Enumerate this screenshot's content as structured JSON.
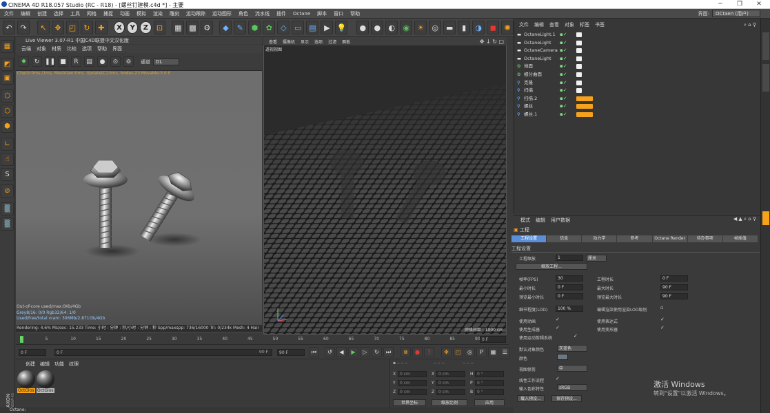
{
  "titlebar": {
    "text": "CINEMA 4D R18.057 Studio (RC - R18) - [螺丝钉建模.c4d *] - 主要",
    "min": "─",
    "max": "❐",
    "close": "✕"
  },
  "menubar": {
    "items": [
      "文件",
      "编辑",
      "创建",
      "选择",
      "工具",
      "网格",
      "捕捉",
      "动画",
      "模拟",
      "渲染",
      "雕刻",
      "运动跟踪",
      "运动图形",
      "角色",
      "流水线",
      "插件",
      "Octane",
      "脚本",
      "窗口",
      "帮助"
    ]
  },
  "interface": {
    "label": "界面:",
    "value": "OCtaen (用户)"
  },
  "live_viewer": {
    "title": "Live Viewer 3.07-R1 中国C4D联盟中文汉化版",
    "menu": [
      "云端",
      "对象",
      "材质",
      "比较",
      "选项",
      "帮助",
      "界面"
    ],
    "channel_label": "通道",
    "channel_value": "DL",
    "check_line": "Check:0ms./1ms. MeshGen:0ms. Update[C]:0ms. Nodes:23 Movable:3  0 0",
    "status": {
      "l1": "Out-of-core used/max:0Kb/4Gb",
      "l2": "Grey8/16: 0/0        Rgb32/64: 1/0",
      "l3": "Used/free/total vram: 306Mb/2.871Gb/4Gb",
      "l4": "Rendering: 4.6%    Ms/sec: 15.233   Time: 小时 : 分钟 : 秒/小时 : 分钟 : 秒    Spp/maxspp: 736/16000   Tri: 0/234k   Mesh: 4   Hair"
    }
  },
  "viewport": {
    "menu": [
      "查看",
      "摄像机",
      "显示",
      "选项",
      "过滤",
      "面板"
    ],
    "label": "透视视图",
    "grid_text": "网格间距 : 1000 cm"
  },
  "timeline": {
    "ticks": [
      "0",
      "5",
      "10",
      "15",
      "20",
      "25",
      "30",
      "35",
      "40",
      "45",
      "50",
      "55",
      "60",
      "65",
      "70",
      "75",
      "80",
      "85",
      "90"
    ],
    "frame_end": "0 F",
    "start": "0 F",
    "current": "0 F",
    "end_a": "90 F",
    "end_b": "90 F"
  },
  "materials": {
    "menu": [
      "创建",
      "编辑",
      "功能",
      "纹理"
    ],
    "items": [
      "OctGlos",
      "OctGlos"
    ]
  },
  "coordinates": {
    "rows": [
      {
        "a": "X",
        "av": "0 cm",
        "b": "X",
        "bv": "0 cm",
        "c": "H",
        "cv": "0 °"
      },
      {
        "a": "Y",
        "av": "0 cm",
        "b": "Y",
        "bv": "0 cm",
        "c": "P",
        "cv": "0 °"
      },
      {
        "a": "Z",
        "av": "0 cm",
        "b": "Z",
        "bv": "0 cm",
        "c": "B",
        "cv": "0 °"
      }
    ],
    "world": "世界坐标",
    "scale": "缩放比例",
    "apply": "应用"
  },
  "object_manager": {
    "menu": [
      "文件",
      "编辑",
      "查看",
      "对象",
      "标签",
      "书签"
    ],
    "objects": [
      "OctaneLight.1",
      "OctaneLight",
      "OctaneCamera",
      "OctaneLight",
      "地面",
      "细分曲面",
      "克隆",
      "扫描",
      "扫描.2",
      "螺丝",
      "螺丝.1"
    ]
  },
  "attributes": {
    "menu": [
      "模式",
      "编辑",
      "用户数据"
    ],
    "section": "工程",
    "tabs": [
      "工程设置",
      "信息",
      "动力学",
      "参考",
      "Octane Render",
      "待办事项",
      "帧插值"
    ],
    "group": "工程设置",
    "scale_label": "工程缩放",
    "scale_value": "1",
    "scale_unit": "厘米",
    "scale_btn": "缩放工程...",
    "fps_label": "帧率(FPS)",
    "fps": "30",
    "duration_label": "工程时长",
    "duration": "0 F",
    "min_label": "最小时长",
    "min": "0 F",
    "max_label": "最大时长",
    "max": "90 F",
    "pmin_label": "预览最小时长",
    "pmin": "0 F",
    "pmax_label": "预览最大时长",
    "pmax": "90 F",
    "lod_label": "细节程度(LOD)",
    "lod": "100 %",
    "lod_check": "编辑渲染使用渲染LOD级别",
    "anim": "使用动画",
    "expr": "使用表达式",
    "gen": "使用生成器",
    "deform": "使用变形器",
    "motion": "使用运动剪辑系统",
    "obj_color_label": "默认对象颜色",
    "obj_color": "灰蓝色",
    "color_label": "颜色",
    "clip_label": "视图修剪",
    "clip": "中",
    "linear_label": "线性工作流程",
    "input_label": "输入色彩特性",
    "input": "sRGB",
    "load_btn": "载入预设...",
    "save_btn": "保存预设..."
  },
  "watermark": {
    "line1": "激活 Windows",
    "line2": "转到\"设置\"以激活 Windows。"
  },
  "statusbar": {
    "text": "Octane:"
  },
  "colors": {
    "accent": "#f7a21b",
    "tab_active": "#5b8ed8",
    "check": "#8ee08e"
  }
}
